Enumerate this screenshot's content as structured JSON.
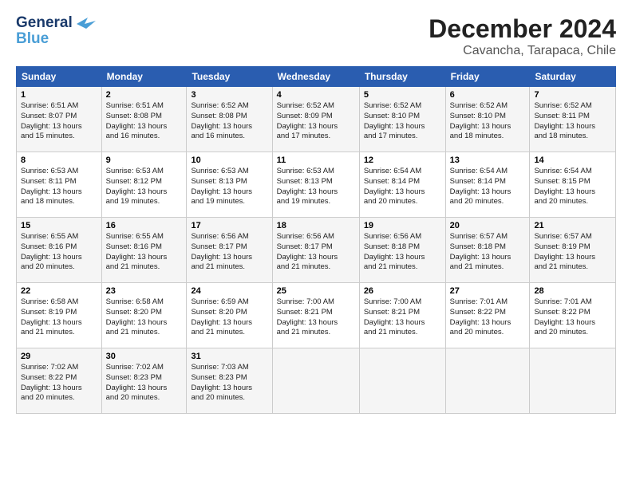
{
  "logo": {
    "line1": "General",
    "line2": "Blue"
  },
  "header": {
    "month": "December 2024",
    "location": "Cavancha, Tarapaca, Chile"
  },
  "weekdays": [
    "Sunday",
    "Monday",
    "Tuesday",
    "Wednesday",
    "Thursday",
    "Friday",
    "Saturday"
  ],
  "weeks": [
    [
      {
        "day": "1",
        "info": "Sunrise: 6:51 AM\nSunset: 8:07 PM\nDaylight: 13 hours\nand 15 minutes."
      },
      {
        "day": "2",
        "info": "Sunrise: 6:51 AM\nSunset: 8:08 PM\nDaylight: 13 hours\nand 16 minutes."
      },
      {
        "day": "3",
        "info": "Sunrise: 6:52 AM\nSunset: 8:08 PM\nDaylight: 13 hours\nand 16 minutes."
      },
      {
        "day": "4",
        "info": "Sunrise: 6:52 AM\nSunset: 8:09 PM\nDaylight: 13 hours\nand 17 minutes."
      },
      {
        "day": "5",
        "info": "Sunrise: 6:52 AM\nSunset: 8:10 PM\nDaylight: 13 hours\nand 17 minutes."
      },
      {
        "day": "6",
        "info": "Sunrise: 6:52 AM\nSunset: 8:10 PM\nDaylight: 13 hours\nand 18 minutes."
      },
      {
        "day": "7",
        "info": "Sunrise: 6:52 AM\nSunset: 8:11 PM\nDaylight: 13 hours\nand 18 minutes."
      }
    ],
    [
      {
        "day": "8",
        "info": "Sunrise: 6:53 AM\nSunset: 8:11 PM\nDaylight: 13 hours\nand 18 minutes."
      },
      {
        "day": "9",
        "info": "Sunrise: 6:53 AM\nSunset: 8:12 PM\nDaylight: 13 hours\nand 19 minutes."
      },
      {
        "day": "10",
        "info": "Sunrise: 6:53 AM\nSunset: 8:13 PM\nDaylight: 13 hours\nand 19 minutes."
      },
      {
        "day": "11",
        "info": "Sunrise: 6:53 AM\nSunset: 8:13 PM\nDaylight: 13 hours\nand 19 minutes."
      },
      {
        "day": "12",
        "info": "Sunrise: 6:54 AM\nSunset: 8:14 PM\nDaylight: 13 hours\nand 20 minutes."
      },
      {
        "day": "13",
        "info": "Sunrise: 6:54 AM\nSunset: 8:14 PM\nDaylight: 13 hours\nand 20 minutes."
      },
      {
        "day": "14",
        "info": "Sunrise: 6:54 AM\nSunset: 8:15 PM\nDaylight: 13 hours\nand 20 minutes."
      }
    ],
    [
      {
        "day": "15",
        "info": "Sunrise: 6:55 AM\nSunset: 8:16 PM\nDaylight: 13 hours\nand 20 minutes."
      },
      {
        "day": "16",
        "info": "Sunrise: 6:55 AM\nSunset: 8:16 PM\nDaylight: 13 hours\nand 21 minutes."
      },
      {
        "day": "17",
        "info": "Sunrise: 6:56 AM\nSunset: 8:17 PM\nDaylight: 13 hours\nand 21 minutes."
      },
      {
        "day": "18",
        "info": "Sunrise: 6:56 AM\nSunset: 8:17 PM\nDaylight: 13 hours\nand 21 minutes."
      },
      {
        "day": "19",
        "info": "Sunrise: 6:56 AM\nSunset: 8:18 PM\nDaylight: 13 hours\nand 21 minutes."
      },
      {
        "day": "20",
        "info": "Sunrise: 6:57 AM\nSunset: 8:18 PM\nDaylight: 13 hours\nand 21 minutes."
      },
      {
        "day": "21",
        "info": "Sunrise: 6:57 AM\nSunset: 8:19 PM\nDaylight: 13 hours\nand 21 minutes."
      }
    ],
    [
      {
        "day": "22",
        "info": "Sunrise: 6:58 AM\nSunset: 8:19 PM\nDaylight: 13 hours\nand 21 minutes."
      },
      {
        "day": "23",
        "info": "Sunrise: 6:58 AM\nSunset: 8:20 PM\nDaylight: 13 hours\nand 21 minutes."
      },
      {
        "day": "24",
        "info": "Sunrise: 6:59 AM\nSunset: 8:20 PM\nDaylight: 13 hours\nand 21 minutes."
      },
      {
        "day": "25",
        "info": "Sunrise: 7:00 AM\nSunset: 8:21 PM\nDaylight: 13 hours\nand 21 minutes."
      },
      {
        "day": "26",
        "info": "Sunrise: 7:00 AM\nSunset: 8:21 PM\nDaylight: 13 hours\nand 21 minutes."
      },
      {
        "day": "27",
        "info": "Sunrise: 7:01 AM\nSunset: 8:22 PM\nDaylight: 13 hours\nand 20 minutes."
      },
      {
        "day": "28",
        "info": "Sunrise: 7:01 AM\nSunset: 8:22 PM\nDaylight: 13 hours\nand 20 minutes."
      }
    ],
    [
      {
        "day": "29",
        "info": "Sunrise: 7:02 AM\nSunset: 8:22 PM\nDaylight: 13 hours\nand 20 minutes."
      },
      {
        "day": "30",
        "info": "Sunrise: 7:02 AM\nSunset: 8:23 PM\nDaylight: 13 hours\nand 20 minutes."
      },
      {
        "day": "31",
        "info": "Sunrise: 7:03 AM\nSunset: 8:23 PM\nDaylight: 13 hours\nand 20 minutes."
      },
      null,
      null,
      null,
      null
    ]
  ]
}
